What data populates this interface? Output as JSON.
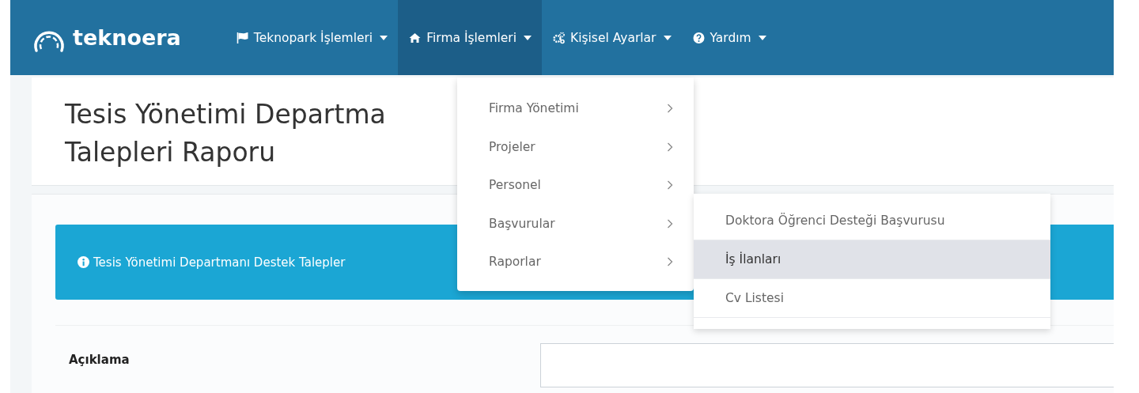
{
  "navbar": {
    "brand": "teknoera",
    "items": [
      {
        "label": "Teknopark İşlemleri",
        "selected": false
      },
      {
        "label": "Firma İşlemleri",
        "selected": true
      },
      {
        "label": "Kişisel Ayarlar",
        "selected": false
      },
      {
        "label": "Yardım",
        "selected": false
      }
    ]
  },
  "dropdown": {
    "items": [
      {
        "label": "Firma Yönetimi",
        "selected": false
      },
      {
        "label": "Projeler",
        "selected": false
      },
      {
        "label": "Personel",
        "selected": false
      },
      {
        "label": "Başvurular",
        "selected": false
      },
      {
        "label": "Raporlar",
        "selected": false
      }
    ]
  },
  "submenu": {
    "items": [
      {
        "label": "Doktora Öğrenci Desteği Başvurusu",
        "selected": false
      },
      {
        "label": "İş İlanları",
        "selected": true
      },
      {
        "label": "Cv Listesi",
        "selected": false
      }
    ]
  },
  "page": {
    "title_lines": [
      "Tesis Yönetimi Departma",
      "Talepleri Raporu"
    ],
    "alert": "Tesis Yönetimi Departmanı Destek Talepler",
    "form": [
      {
        "label": "Açıklama"
      }
    ]
  }
}
